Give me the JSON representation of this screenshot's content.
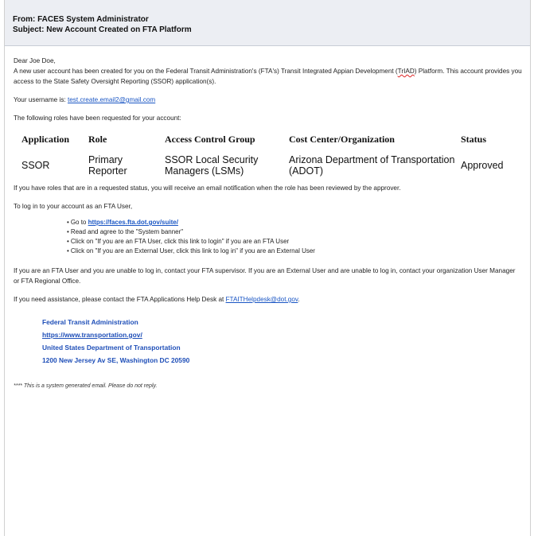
{
  "header": {
    "from": "From: FACES System Administrator",
    "subject": "Subject: New Account Created on FTA Platform"
  },
  "body": {
    "greeting": "Dear Joe Doe,",
    "intro_1": "A new user account has been created for you on the Federal Transit Administration's (FTA's) Transit Integrated Appian Development (",
    "intro_squiggle": "TrIAD",
    "intro_2": ") Platform. This account provides you access to the State Safety Oversight Reporting (SSOR) application(s).",
    "username_label": "Your username is: ",
    "username_value": "test.create.email2@gmail.com",
    "roles_intro": "The following roles have been requested for your account:",
    "table": {
      "headers": [
        "Application",
        "Role",
        "Access Control Group",
        "Cost Center/Organization",
        "Status"
      ],
      "rows": [
        [
          "SSOR",
          "Primary Reporter",
          "SSOR Local Security Managers (LSMs)",
          "Arizona Department of Transportation (ADOT)",
          "Approved"
        ]
      ]
    },
    "requested_note": "If you have roles that are in a requested status, you will receive an email notification when the role has been reviewed by the approver.",
    "login_intro": "To log in to your account as an FTA User,",
    "steps": {
      "go_to": "Go to ",
      "go_to_link": "https://faces.fta.dot.gov/suite/",
      "read": "Read and agree to the \"System banner\"",
      "fta_user": "Click on \"If you are an FTA User, click this link to login\" if you are an FTA User",
      "external_user": "Click on \"If you are an External User, click this link to log in\" if you are an External User"
    },
    "unable_note": "If you are an FTA User and you are unable to log in, contact your FTA supervisor. If you are an External User and are unable to log in, contact your organization User Manager or FTA Regional Office.",
    "help_text": "If you need assistance, please contact the FTA Applications Help Desk at ",
    "help_email": "FTAITHelpdesk@dot.gov",
    "help_end": "."
  },
  "signature": {
    "org": "Federal Transit Administration",
    "url": "https://www.transportation.gov/",
    "dept": "United States Department of Transportation",
    "address": "1200 New Jersey Av SE, Washington DC 20590"
  },
  "footer": "**** This is a system generated email. Please do not reply."
}
